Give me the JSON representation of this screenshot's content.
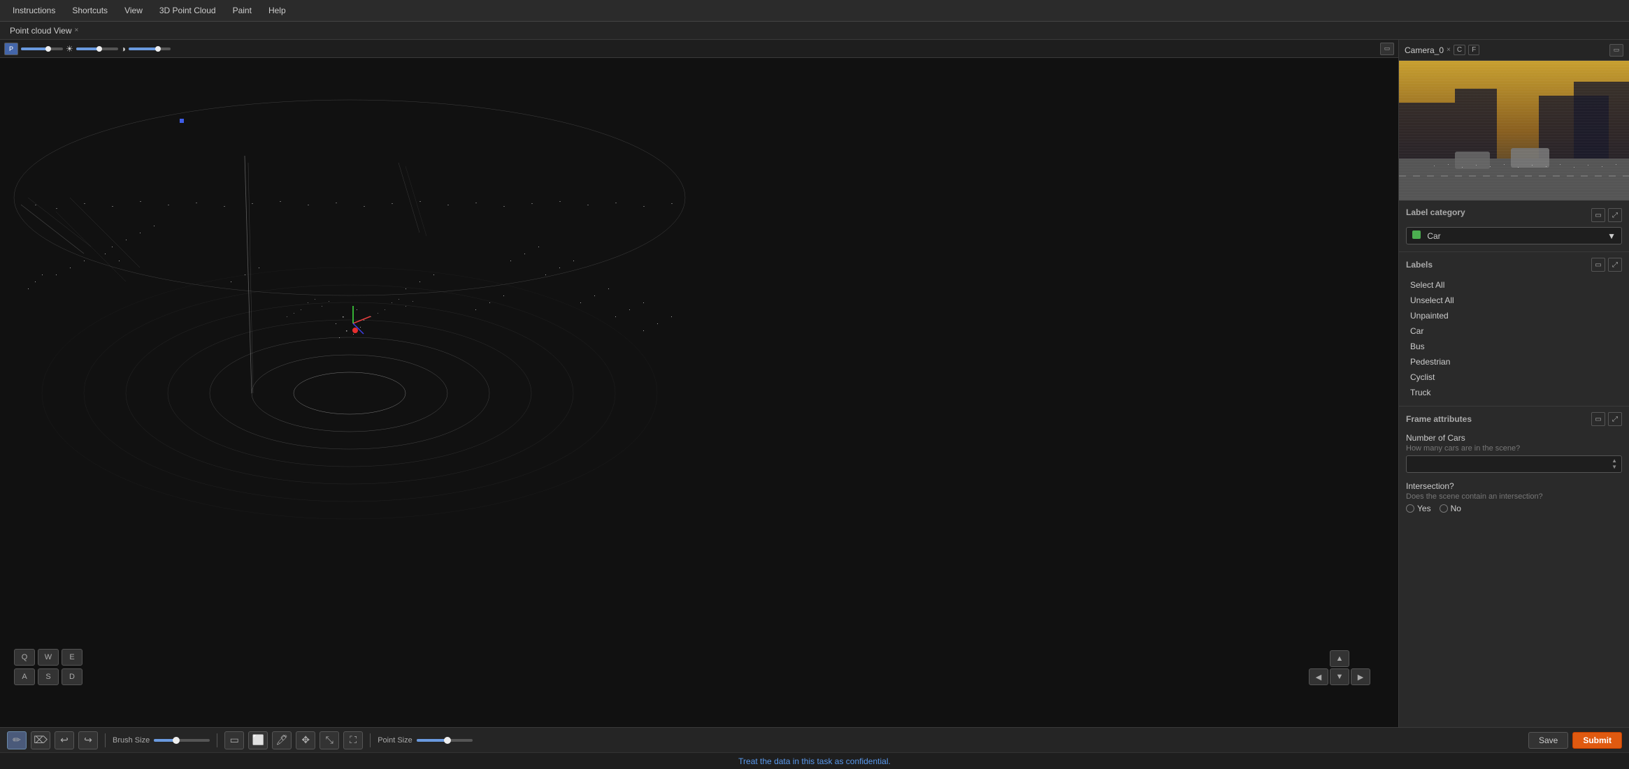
{
  "menubar": {
    "items": [
      {
        "label": "Instructions",
        "id": "instructions"
      },
      {
        "label": "Shortcuts",
        "id": "shortcuts"
      },
      {
        "label": "View",
        "id": "view"
      },
      {
        "label": "3D Point Cloud",
        "id": "3d-point-cloud"
      },
      {
        "label": "Paint",
        "id": "paint"
      },
      {
        "label": "Help",
        "id": "help"
      }
    ]
  },
  "tabs": [
    {
      "label": "Point cloud View",
      "closable": true
    }
  ],
  "pcl_toolbar": {
    "p_badge": "P",
    "brightness_icon": "☀",
    "contrast_icon": "◑"
  },
  "camera": {
    "label": "Camera_0",
    "badges": [
      "C",
      "F"
    ],
    "close": "×"
  },
  "label_category": {
    "title": "Label category",
    "selected": "Car",
    "color": "#4caf50",
    "options": [
      "Car",
      "Bus",
      "Pedestrian",
      "Cyclist",
      "Truck"
    ]
  },
  "labels": {
    "title": "Labels",
    "items": [
      {
        "label": "Select All"
      },
      {
        "label": "Unselect All"
      },
      {
        "label": "Unpainted"
      },
      {
        "label": "Car"
      },
      {
        "label": "Bus"
      },
      {
        "label": "Pedestrian"
      },
      {
        "label": "Cyclist"
      },
      {
        "label": "Truck"
      }
    ]
  },
  "frame_attributes": {
    "title": "Frame attributes",
    "fields": [
      {
        "label": "Number of Cars",
        "description": "How many cars are in the scene?",
        "type": "number",
        "value": ""
      },
      {
        "label": "Intersection?",
        "description": "Does the scene contain an intersection?",
        "type": "radio",
        "options": [
          "Yes",
          "No"
        ]
      }
    ]
  },
  "bottom_toolbar": {
    "brush_size_label": "Brush Size",
    "point_size_label": "Point Size",
    "brush_size_pct": 40,
    "point_size_pct": 55,
    "tools": [
      {
        "name": "draw-tool",
        "icon": "✏",
        "active": true
      },
      {
        "name": "erase-tool",
        "icon": "⌫",
        "active": false
      },
      {
        "name": "undo-tool",
        "icon": "↩",
        "active": false
      },
      {
        "name": "redo-tool",
        "icon": "↪",
        "active": false
      },
      {
        "name": "rectangle-tool",
        "icon": "□",
        "active": false
      },
      {
        "name": "polygon-tool",
        "icon": "⬡",
        "active": false
      },
      {
        "name": "lasso-tool",
        "icon": "~",
        "active": false
      },
      {
        "name": "move-tool",
        "icon": "✥",
        "active": false
      },
      {
        "name": "resize-tool",
        "icon": "⤡",
        "active": false
      },
      {
        "name": "fullscreen-tool",
        "icon": "⛶",
        "active": false
      }
    ]
  },
  "action_buttons": {
    "save_label": "Save",
    "submit_label": "Submit"
  },
  "status_bar": {
    "message": "Treat the data in this task as confidential."
  },
  "keyboard_hints": {
    "rows": [
      [
        "Q",
        "W",
        "E"
      ],
      [
        "A",
        "S",
        "D"
      ]
    ]
  },
  "nav_arrows": {
    "up": "▲",
    "left": "◀",
    "down": "▼",
    "right": "▶"
  }
}
